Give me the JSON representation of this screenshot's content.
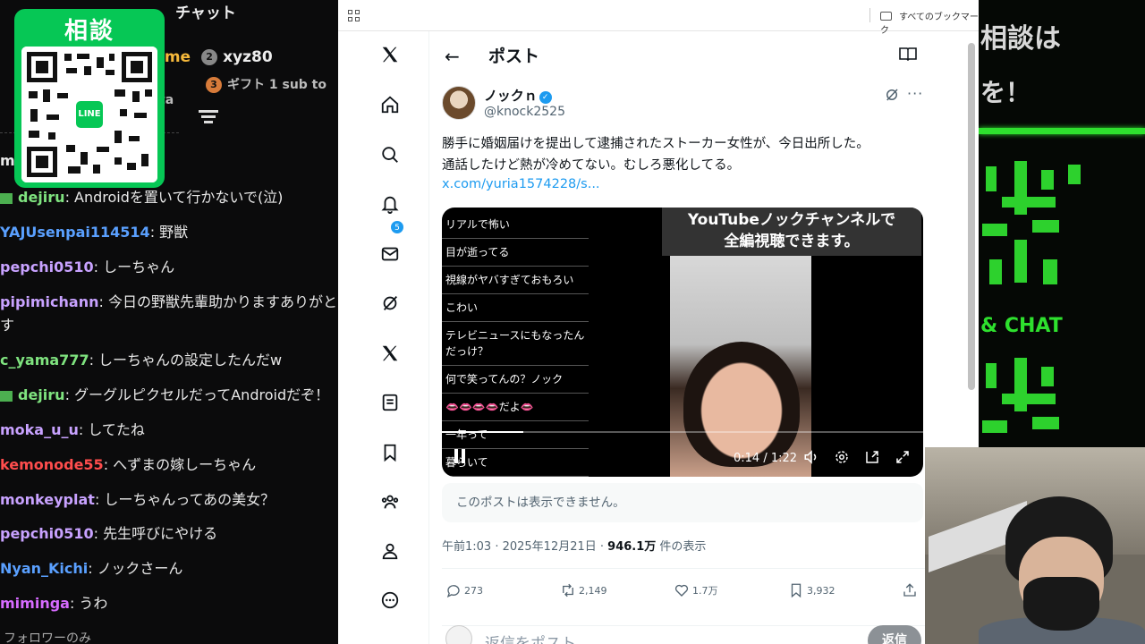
{
  "chat": {
    "title": "チャット",
    "gift_rows": [
      {
        "rank": "2",
        "prefix": "ime",
        "text": "xyz80"
      },
      {
        "rank": "3",
        "prefix": "",
        "text": "ギフト 1 sub to ta"
      }
    ],
    "follower_only": "フォロワーのみ",
    "messages": [
      {
        "user": "mo",
        "text": "",
        "color": "#e8e8e8"
      },
      {
        "user": "dejiru",
        "text": ": Androidを置いて行かないで(泣)",
        "color": "#7fe37f",
        "badge": true
      },
      {
        "user": "YAJUsenpai114514",
        "text": ": 野獣",
        "color": "#5aa0ff"
      },
      {
        "user": "pepchi0510",
        "text": ": しーちゃん",
        "color": "#c8a2ff"
      },
      {
        "user": "pipimichann",
        "text": ": 今日の野獣先輩助かりますありがと",
        "color": "#c8a2ff"
      },
      {
        "user": "",
        "text": "す",
        "color": "#e8e8e8"
      },
      {
        "user": "c_yama777",
        "text": ": しーちゃんの設定したんだw",
        "color": "#7fe37f"
      },
      {
        "user": "dejiru",
        "text": ": グーグルピクセルだってAndroidだぞ！",
        "color": "#7fe37f",
        "badge": true
      },
      {
        "user": "moka_u_u",
        "text": ": してたね",
        "color": "#c8a2ff"
      },
      {
        "user": "kemonode55",
        "text": ": へずまの嫁しーちゃん",
        "color": "#ff4d4d"
      },
      {
        "user": "monkeyplat",
        "text": ": しーちゃんってあの美女？",
        "color": "#c8a2ff"
      },
      {
        "user": "pepchi0510",
        "text": ": 先生呼びにやける",
        "color": "#c8a2ff"
      },
      {
        "user": "Nyan_Kichi",
        "text": ": ノックさーん",
        "color": "#5aa0ff"
      },
      {
        "user": "miminga",
        "text": ": うわ",
        "color": "#d66bff"
      }
    ]
  },
  "consult": {
    "title": "相談",
    "line_label": "LINE"
  },
  "browser": {
    "all_bookmarks": "すべてのブックマーク"
  },
  "x_nav": {
    "items": [
      "x-logo",
      "home-icon",
      "search-icon",
      "bell-icon",
      "mail-icon",
      "grok-icon",
      "x-premium-icon",
      "lists-icon",
      "bookmark-icon",
      "communities-icon",
      "profile-icon",
      "more-icon"
    ],
    "notif_count": "5"
  },
  "post": {
    "header_title": "ポスト",
    "author_name": "ノックｎ",
    "author_handle": "@knock2525",
    "text_line1": "勝手に婚姻届けを提出して逮捕されたストーカー女性が、今日出所した。",
    "text_line2": "通話したけど熱が冷めてない。むしろ悪化してる。",
    "link": "x.com/yuria1574228/s...",
    "video": {
      "banner_line1": "YouTubeノックチャンネルで",
      "banner_line2": "全編視聴できます。",
      "comments": [
        "リアルで怖い",
        "目が逝ってる",
        "視線がヤバすぎておもろい",
        "こわい",
        "テレビニュースにもなったんだっけ？",
        "何で笑ってんの？ノック",
        "👄👄👄👄だよ👄",
        "一年って",
        "暮らいて"
      ],
      "time": "0:14 / 1:22",
      "progress": 0.17
    },
    "unavailable": "このポストは表示できません。",
    "meta_time": "午前1:03 · 2025年12月21日 · ",
    "meta_views": "946.1万",
    "meta_views_suffix": " 件の表示",
    "stats": {
      "replies": "273",
      "reposts": "2,149",
      "likes": "1.7万",
      "bookmarks": "3,932"
    },
    "reply_placeholder": "返信をポスト",
    "reply_button": "返信"
  },
  "game": {
    "line1": "相談は",
    "line2": "を！",
    "line3": "& CHAT"
  },
  "colors": {
    "x_blue": "#1d9bf0",
    "line_green": "#06c755",
    "game_green": "#2ee02e"
  }
}
